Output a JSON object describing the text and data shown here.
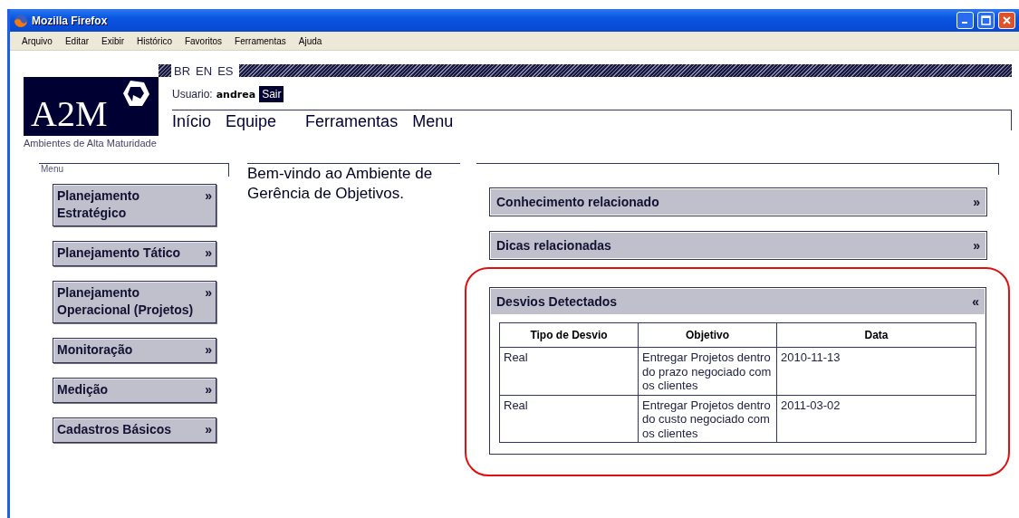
{
  "window": {
    "title": "Mozilla Firefox"
  },
  "menu_bar": [
    "Arquivo",
    "Editar",
    "Exibir",
    "Histórico",
    "Favoritos",
    "Ferramentas",
    "Ajuda"
  ],
  "languages": [
    "BR",
    "EN",
    "ES"
  ],
  "logo": {
    "text": "A2M",
    "subtitle": "Ambientes de Alta Maturidade"
  },
  "user": {
    "label": "Usuario:",
    "name": "andrea",
    "logout": "Sair"
  },
  "nav": [
    "Início",
    "Equipe",
    "Ferramentas",
    "Menu"
  ],
  "sidebar": {
    "title": "Menu",
    "items": [
      {
        "label": "Planejamento Estratégico",
        "toggle": "»"
      },
      {
        "label": "Planejamento Tático",
        "toggle": "»"
      },
      {
        "label": "Planejamento Operacional (Projetos)",
        "toggle": "»"
      },
      {
        "label": "Monitoração",
        "toggle": "»"
      },
      {
        "label": "Medição",
        "toggle": "»"
      },
      {
        "label": "Cadastros Básicos",
        "toggle": "»"
      }
    ]
  },
  "welcome": "Bem-vindo ao Ambiente de Gerência de Objetivos.",
  "panels": [
    {
      "title": "Conhecimento relacionado",
      "toggle": "»",
      "expanded": false,
      "highlighted": false
    },
    {
      "title": "Dicas relacionadas",
      "toggle": "»",
      "expanded": false,
      "highlighted": false
    },
    {
      "title": "Desvios Detectados",
      "toggle": "«",
      "expanded": true,
      "highlighted": true,
      "table": {
        "columns": [
          "Tipo de Desvio",
          "Objetivo",
          "Data"
        ],
        "rows": [
          [
            "Real",
            "Entregar Projetos dentro do prazo negociado com os clientes",
            "2010-11-13"
          ],
          [
            "Real",
            "Entregar Projetos dentro do custo negociado com os clientes",
            "2011-03-02"
          ]
        ]
      }
    }
  ]
}
